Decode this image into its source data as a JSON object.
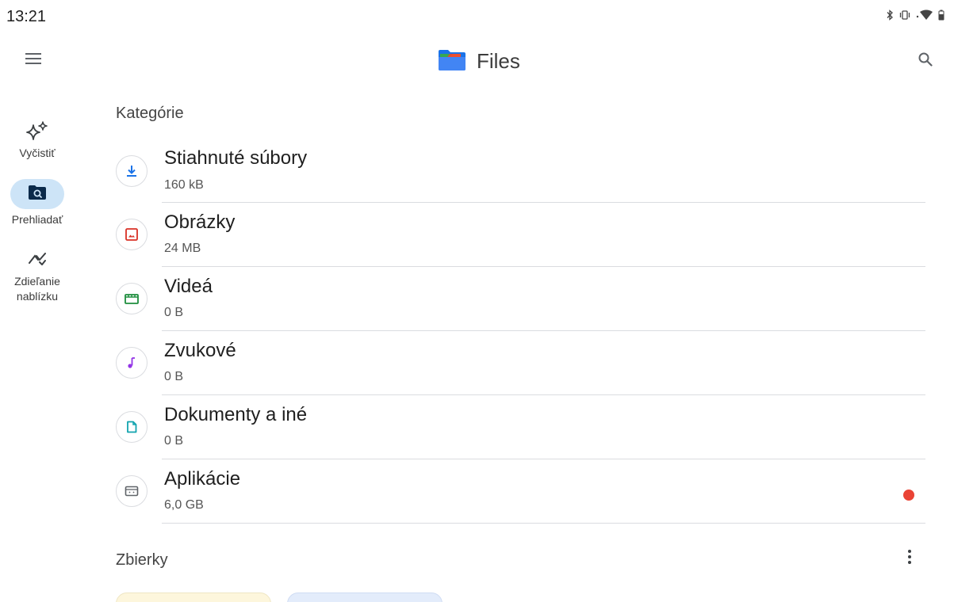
{
  "status_bar": {
    "time": "13:21",
    "icons": [
      "bluetooth-icon",
      "vibrate-icon",
      "wifi-icon",
      "battery-icon"
    ]
  },
  "app_bar": {
    "title": "Files",
    "menu_icon": "hamburger-menu-icon",
    "search_icon": "search-icon"
  },
  "nav": {
    "items": [
      {
        "label": "Vyčistiť",
        "icon": "sparkle-icon",
        "active": false
      },
      {
        "label": "Prehliadať",
        "icon": "folder-search-icon",
        "active": true
      },
      {
        "label": "Zdieľanie nablízku",
        "icon": "nearby-share-icon",
        "active": false
      }
    ]
  },
  "categories": {
    "title": "Kategórie",
    "items": [
      {
        "name": "Stiahnuté súbory",
        "size": "160 kB",
        "icon": "download-icon",
        "color": "#1a73e8"
      },
      {
        "name": "Obrázky",
        "size": "24 MB",
        "icon": "image-icon",
        "color": "#d93025"
      },
      {
        "name": "Videá",
        "size": "0 B",
        "icon": "video-icon",
        "color": "#1e8e3e"
      },
      {
        "name": "Zvukové",
        "size": "0 B",
        "icon": "audio-icon",
        "color": "#9334e6"
      },
      {
        "name": "Dokumenty a iné",
        "size": "0 B",
        "icon": "document-icon",
        "color": "#12a4af"
      },
      {
        "name": "Aplikácie",
        "size": "6,0 GB",
        "icon": "android-app-icon",
        "color": "#5f6368",
        "badge": true,
        "badge_color": "#ea4335"
      }
    ]
  },
  "collections": {
    "title": "Zbierky",
    "more_icon": "more-vert-icon",
    "card_colors": [
      "#fdf6dc",
      "#e3ecfb"
    ]
  }
}
